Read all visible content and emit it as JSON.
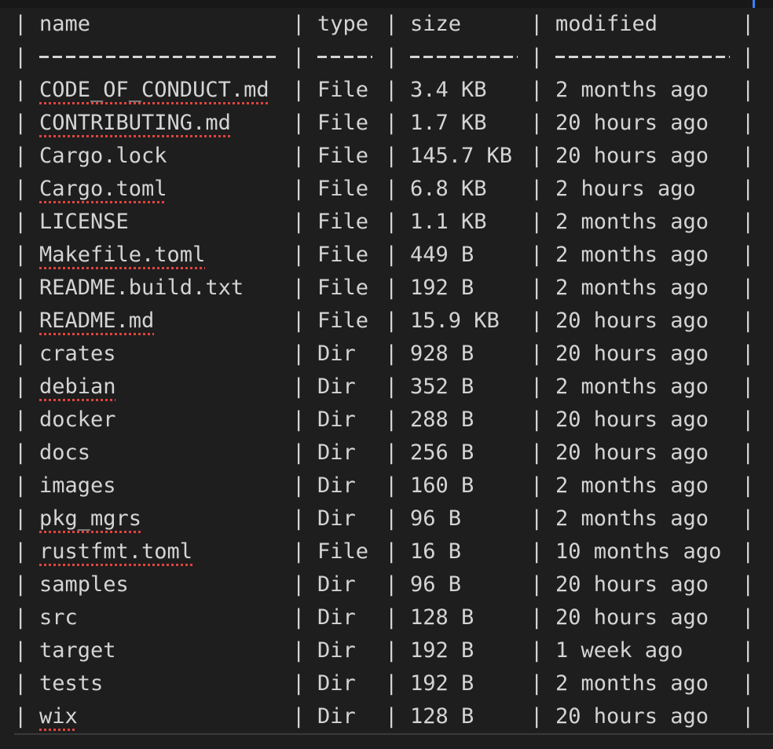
{
  "table": {
    "headers": {
      "name": "name",
      "type": "type",
      "size": "size",
      "modified": "modified"
    },
    "rows": [
      {
        "name": "CODE_OF_CONDUCT.md",
        "type": "File",
        "size": "3.4 KB",
        "modified": "2 months ago",
        "spell": true
      },
      {
        "name": "CONTRIBUTING.md",
        "type": "File",
        "size": "1.7 KB",
        "modified": "20 hours ago",
        "spell": true
      },
      {
        "name": "Cargo.lock",
        "type": "File",
        "size": "145.7 KB",
        "modified": "20 hours ago",
        "spell": false
      },
      {
        "name": "Cargo.toml",
        "type": "File",
        "size": "6.8 KB",
        "modified": "2 hours ago",
        "spell": true
      },
      {
        "name": "LICENSE",
        "type": "File",
        "size": "1.1 KB",
        "modified": "2 months ago",
        "spell": false
      },
      {
        "name": "Makefile.toml",
        "type": "File",
        "size": "449 B",
        "modified": "2 months ago",
        "spell": true
      },
      {
        "name": "README.build.txt",
        "type": "File",
        "size": "192 B",
        "modified": "2 months ago",
        "spell": false
      },
      {
        "name": "README.md",
        "type": "File",
        "size": "15.9 KB",
        "modified": "20 hours ago",
        "spell": true
      },
      {
        "name": "crates",
        "type": "Dir",
        "size": "928 B",
        "modified": "20 hours ago",
        "spell": false
      },
      {
        "name": "debian",
        "type": "Dir",
        "size": "352 B",
        "modified": "2 months ago",
        "spell": true
      },
      {
        "name": "docker",
        "type": "Dir",
        "size": "288 B",
        "modified": "20 hours ago",
        "spell": false
      },
      {
        "name": "docs",
        "type": "Dir",
        "size": "256 B",
        "modified": "20 hours ago",
        "spell": false
      },
      {
        "name": "images",
        "type": "Dir",
        "size": "160 B",
        "modified": "2 months ago",
        "spell": false
      },
      {
        "name": "pkg_mgrs",
        "type": "Dir",
        "size": "96 B",
        "modified": "2 months ago",
        "spell": true
      },
      {
        "name": "rustfmt.toml",
        "type": "File",
        "size": "16 B",
        "modified": "10 months ago",
        "spell": true
      },
      {
        "name": "samples",
        "type": "Dir",
        "size": "96 B",
        "modified": "20 hours ago",
        "spell": false
      },
      {
        "name": "src",
        "type": "Dir",
        "size": "128 B",
        "modified": "20 hours ago",
        "spell": false
      },
      {
        "name": "target",
        "type": "Dir",
        "size": "192 B",
        "modified": "1 week ago",
        "spell": false
      },
      {
        "name": "tests",
        "type": "Dir",
        "size": "192 B",
        "modified": "2 months ago",
        "spell": false
      },
      {
        "name": "wix",
        "type": "Dir",
        "size": "128 B",
        "modified": "20 hours ago",
        "spell": true
      }
    ]
  },
  "colors": {
    "background": "#1e1e1e",
    "text": "#d4d4d4",
    "spellcheck_underline": "#e0443e",
    "cursor": "#3b82f6"
  }
}
